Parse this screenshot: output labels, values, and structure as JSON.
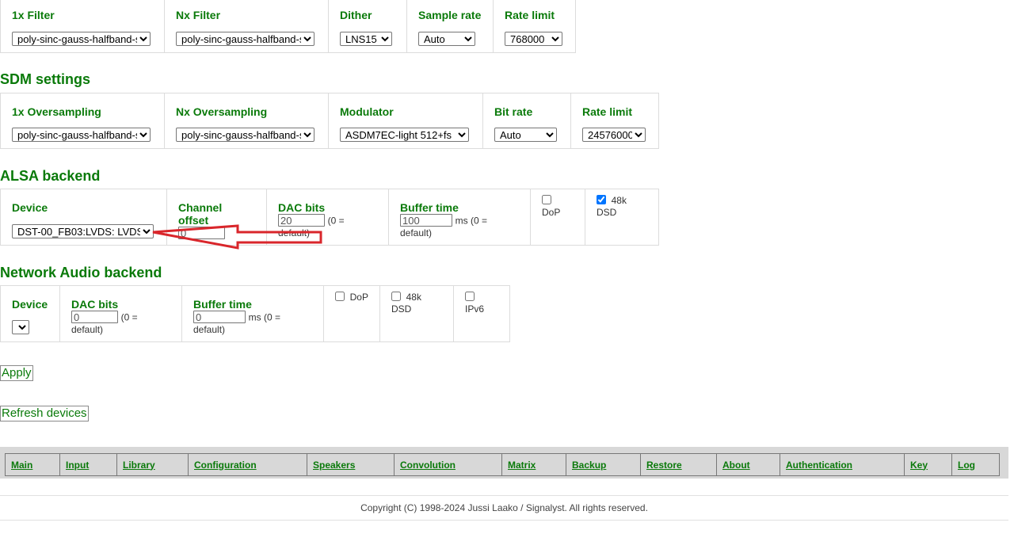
{
  "pcm": {
    "filter1x": {
      "label": "1x Filter",
      "value": "poly-sinc-gauss-halfband-s"
    },
    "filterNx": {
      "label": "Nx Filter",
      "value": "poly-sinc-gauss-halfband-s"
    },
    "dither": {
      "label": "Dither",
      "value": "LNS15"
    },
    "sample_rate": {
      "label": "Sample rate",
      "value": "Auto"
    },
    "rate_limit": {
      "label": "Rate limit",
      "value": "768000"
    }
  },
  "sdm": {
    "title": "SDM settings",
    "os1x": {
      "label": "1x Oversampling",
      "value": "poly-sinc-gauss-halfband-s"
    },
    "osNx": {
      "label": "Nx Oversampling",
      "value": "poly-sinc-gauss-halfband-s"
    },
    "modulator": {
      "label": "Modulator",
      "value": "ASDM7EC-light 512+fs"
    },
    "bit_rate": {
      "label": "Bit rate",
      "value": "Auto"
    },
    "rate_limit": {
      "label": "Rate limit",
      "value": "24576000"
    }
  },
  "alsa": {
    "title": "ALSA backend",
    "device": {
      "label": "Device",
      "value": "DST-00_FB03:LVDS: LVDS"
    },
    "channel_offset": {
      "label": "Channel offset",
      "value": "0"
    },
    "dac_bits": {
      "label": "DAC bits",
      "value": "20",
      "hint": "(0 = default)"
    },
    "buffer_time": {
      "label": "Buffer time",
      "value": "100",
      "hint": "ms (0 = default)"
    },
    "dop": {
      "label": "DoP",
      "checked": false
    },
    "dsd48k": {
      "label": "48k DSD",
      "checked": true
    }
  },
  "network": {
    "title": "Network Audio backend",
    "device": {
      "label": "Device",
      "value": ""
    },
    "dac_bits": {
      "label": "DAC bits",
      "value": "0",
      "hint": "(0 = default)"
    },
    "buffer_time": {
      "label": "Buffer time",
      "value": "0",
      "hint": "ms (0 = default)"
    },
    "dop": {
      "label": "DoP",
      "checked": false
    },
    "dsd48k": {
      "label": "48k DSD",
      "checked": false
    },
    "ipv6": {
      "label": "IPv6",
      "checked": false
    }
  },
  "buttons": {
    "apply": "Apply",
    "refresh": "Refresh devices"
  },
  "nav": [
    "Main",
    "Input",
    "Library",
    "Configuration",
    "Speakers",
    "Convolution",
    "Matrix",
    "Backup",
    "Restore",
    "About",
    "Authentication",
    "Key",
    "Log"
  ],
  "footer": "Copyright (C) 1998-2024 Jussi Laako / Signalyst. All rights reserved.",
  "colors": {
    "accent": "#0a7a0a",
    "annotation_arrow": "#d9262b",
    "nav_bg": "#d8d8d8"
  }
}
